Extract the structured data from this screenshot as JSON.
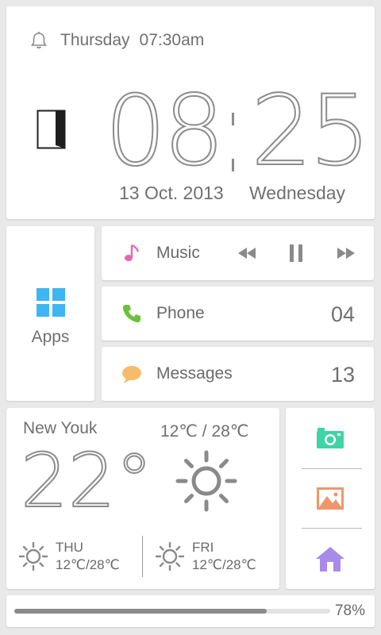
{
  "clock": {
    "alarm_day": "Thursday",
    "alarm_time": "07:30am",
    "hours": "08",
    "minutes": "25",
    "date": "13 Oct. 2013",
    "weekday": "Wednesday"
  },
  "apps": {
    "label": "Apps",
    "icon": "grid-icon",
    "accent": "#3db6f2"
  },
  "music": {
    "label": "Music",
    "icon": "music-note-icon",
    "accent": "#e766b0"
  },
  "phone": {
    "label": "Phone",
    "count": "04",
    "icon": "phone-icon",
    "accent": "#6cc03a"
  },
  "messages": {
    "label": "Messages",
    "count": "13",
    "icon": "chat-bubble-icon",
    "accent": "#f5bd6b"
  },
  "weather": {
    "city": "New Youk",
    "range": "12℃ / 28℃",
    "temp": "22°",
    "forecast": [
      {
        "day": "THU",
        "range": "12℃/28℃"
      },
      {
        "day": "FRI",
        "range": "12℃/28℃"
      }
    ]
  },
  "shortcuts": {
    "camera_color": "#3fd3a6",
    "gallery_color": "#f0966a",
    "home_color": "#a88be8"
  },
  "battery": {
    "percent_label": "78%",
    "level": 0.8
  }
}
